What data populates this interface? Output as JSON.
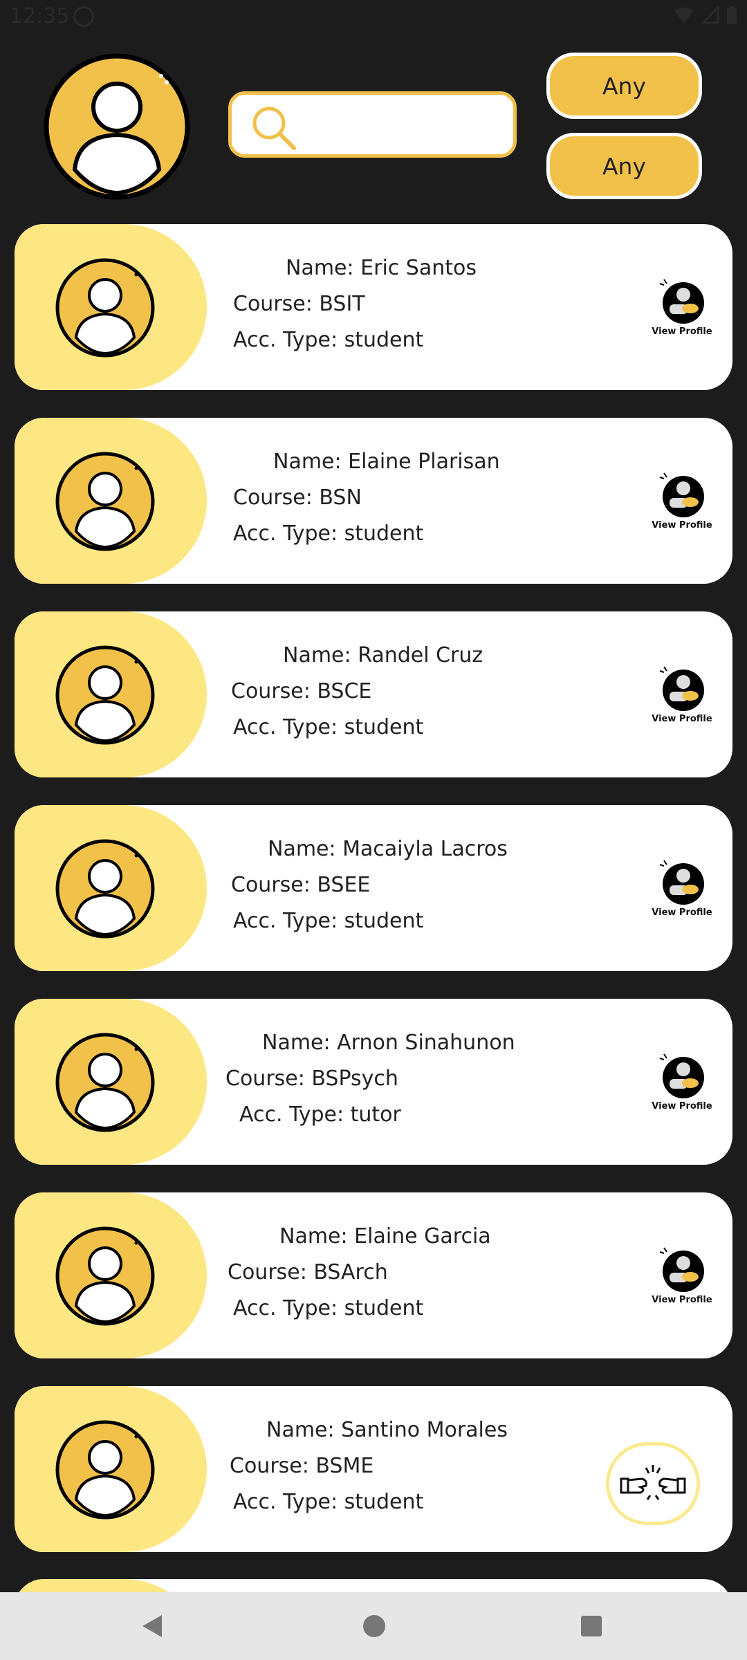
{
  "status_bar": {
    "time": "12:35"
  },
  "search": {
    "placeholder": "",
    "value": ""
  },
  "filters": [
    {
      "label": "Any"
    },
    {
      "label": "Any"
    }
  ],
  "users": [
    {
      "name_label": "Name: Eric Santos",
      "course_label": "Course: BSIT",
      "type_label": "Acc. Type: student"
    },
    {
      "name_label": "Name: Elaine Plarisan",
      "course_label": "Course: BSN",
      "type_label": "Acc. Type: student"
    },
    {
      "name_label": "Name: Randel Cruz",
      "course_label": "Course: BSCE",
      "type_label": "Acc. Type: student"
    },
    {
      "name_label": "Name: Macaiyla Lacros",
      "course_label": "Course: BSEE",
      "type_label": "Acc. Type: student"
    },
    {
      "name_label": "Name: Arnon Sinahunon",
      "course_label": "Course: BSPsych",
      "type_label": "Acc. Type: tutor"
    },
    {
      "name_label": "Name: Elaine Garcia",
      "course_label": "Course: BSArch",
      "type_label": "Acc. Type: student"
    },
    {
      "name_label": "Name: Santino Morales",
      "course_label": "Course: BSME",
      "type_label": "Acc. Type: student"
    }
  ],
  "view_profile_label": "View Profile",
  "colors": {
    "accent": "#f2c14a",
    "card_left": "#fde783",
    "background": "#1c1c1c"
  }
}
